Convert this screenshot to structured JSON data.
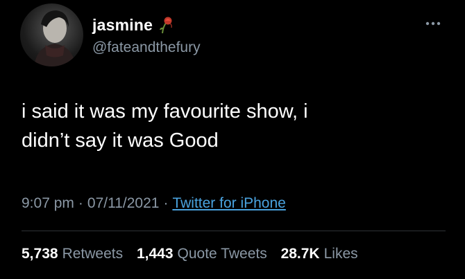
{
  "user": {
    "display_name": "jasmine",
    "handle": "@fateandthefury",
    "badge_icon": "wilted-rose-icon",
    "avatar": "avatar-image"
  },
  "menu": {
    "icon": "more-icon"
  },
  "tweet": {
    "line1": "i said it was my favourite show, i",
    "line2": "didn’t say it was Good"
  },
  "meta": {
    "time": "9:07 pm",
    "separator": "·",
    "date": "07/11/2021",
    "source": "Twitter for iPhone"
  },
  "stats": {
    "retweets": {
      "count": "5,738",
      "label": "Retweets"
    },
    "quotes": {
      "count": "1,443",
      "label": "Quote Tweets"
    },
    "likes": {
      "count": "28.7K",
      "label": "Likes"
    }
  },
  "colors": {
    "background": "#000000",
    "text": "#ffffff",
    "muted": "#8b98a5",
    "link": "#4aa3df",
    "divider": "#2f3336"
  }
}
